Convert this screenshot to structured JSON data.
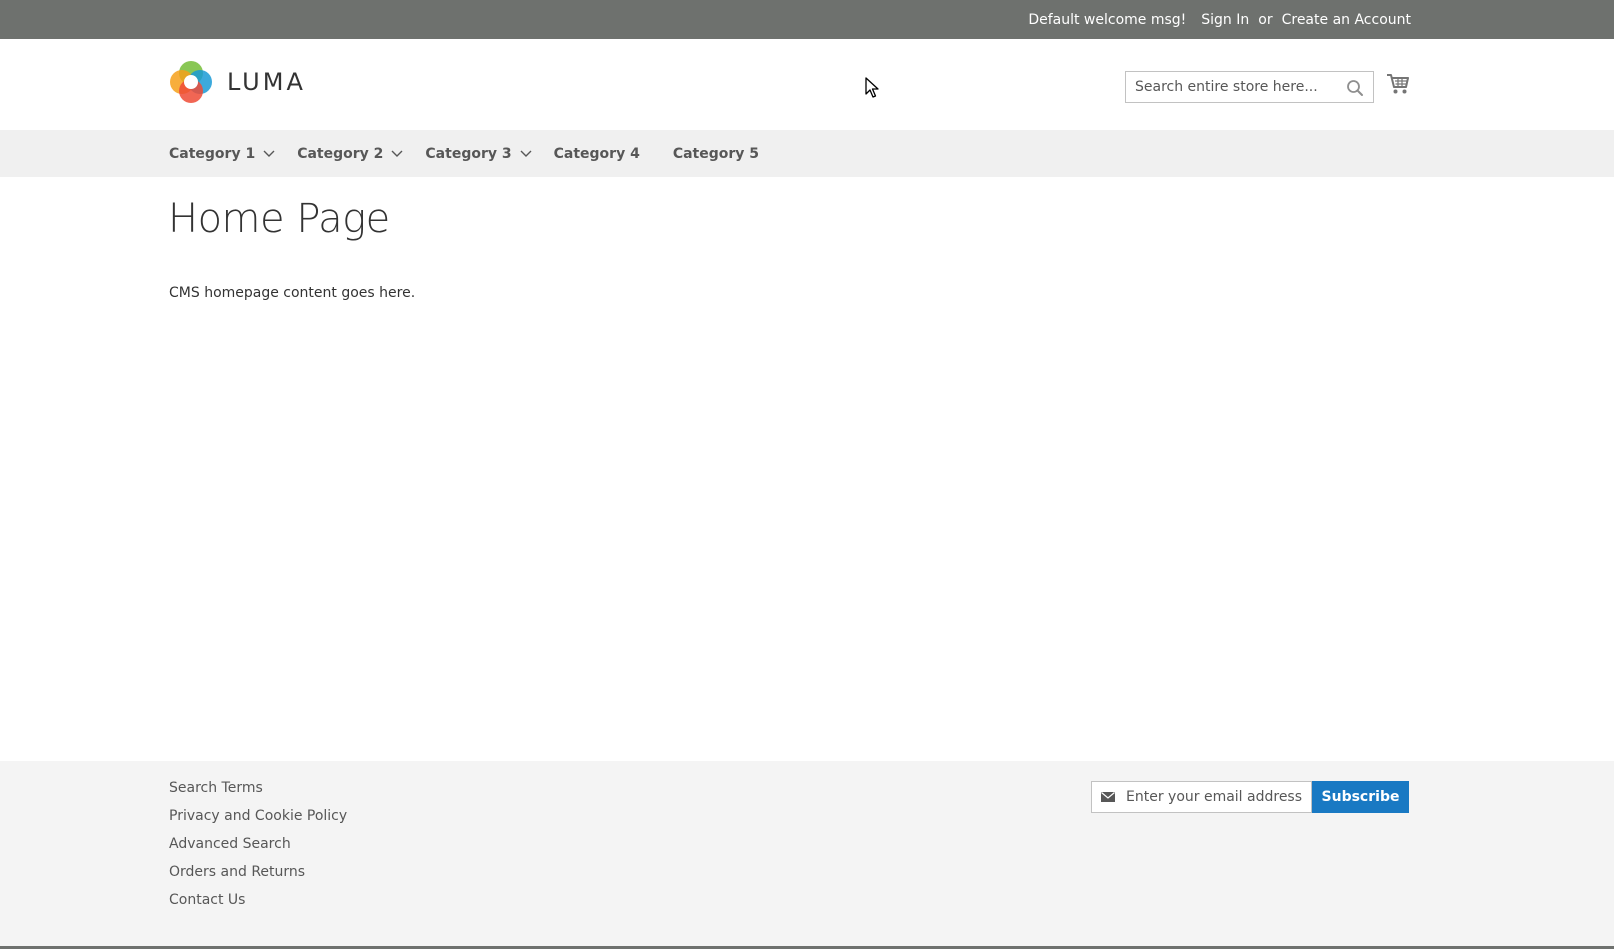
{
  "panel": {
    "welcome": "Default welcome msg!",
    "sign_in": "Sign In",
    "or": "or",
    "create_account": "Create an Account"
  },
  "header": {
    "logo_text": "LUMA",
    "search_placeholder": "Search entire store here...",
    "icons": {
      "search": "search-icon",
      "cart": "cart-icon"
    }
  },
  "nav": {
    "items": [
      {
        "label": "Category 1",
        "has_submenu": true
      },
      {
        "label": "Category 2",
        "has_submenu": true
      },
      {
        "label": "Category 3",
        "has_submenu": true
      },
      {
        "label": "Category 4",
        "has_submenu": false
      },
      {
        "label": "Category 5",
        "has_submenu": false
      }
    ]
  },
  "main": {
    "title": "Home Page",
    "content": "CMS homepage content goes here."
  },
  "footer": {
    "links": [
      "Search Terms",
      "Privacy and Cookie Policy",
      "Advanced Search",
      "Orders and Returns",
      "Contact Us"
    ],
    "newsletter": {
      "placeholder": "Enter your email address",
      "button": "Subscribe"
    }
  },
  "colors": {
    "panel_bg": "#6e716e",
    "nav_bg": "#f0f0f0",
    "footer_bg": "#f4f4f4",
    "accent": "#1979c3"
  }
}
